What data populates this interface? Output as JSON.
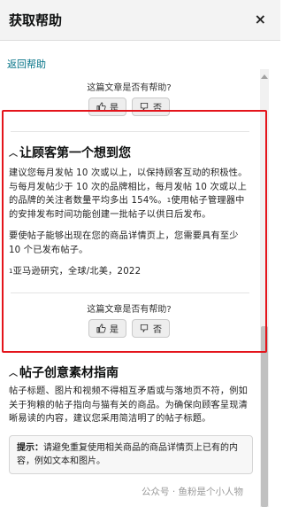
{
  "header": {
    "title": "获取帮助",
    "close_label": "×"
  },
  "back_link": "返回帮助",
  "feedback": {
    "question": "这篇文章是否有帮助?",
    "yes": "是",
    "no": "否"
  },
  "section1": {
    "title": "让顾客第一个想到您",
    "p1": "建议您每月发帖 10 次或以上，以保持顾客互动的积极性。与每月发帖少于 10 次的品牌相比，每月发帖 10 次或以上的品牌的关注者数量平均多出 154%。",
    "p1_sup": "1",
    "p1_tail": "使用帖子管理器中的安排发布时间功能创建一批帖子以供日后发布。",
    "p2": "要使帖子能够出现在您的商品详情页上，您需要具有至少 10 个已发布帖子。",
    "note_sup": "1",
    "note": "亚马逊研究，全球/北美，2022"
  },
  "section2": {
    "title": "帖子创意素材指南",
    "body": "帖子标题、图片和视频不得相互矛盾或与落地页不符，例如关于狗粮的帖子指向与猫有关的商品。为确保向顾客呈现清晰易读的内容，建议您采用简洁明了的帖子标题。",
    "tip_label": "提示：",
    "tip_text": "请避免重复使用相关商品的商品详情页上已有的内容，例如文本和图片。"
  },
  "watermark": "公众号 · 鱼粉是个小人物",
  "colors": {
    "highlight_border": "#e4141b",
    "link": "#007185",
    "header_bg": "#f3f3f3"
  }
}
